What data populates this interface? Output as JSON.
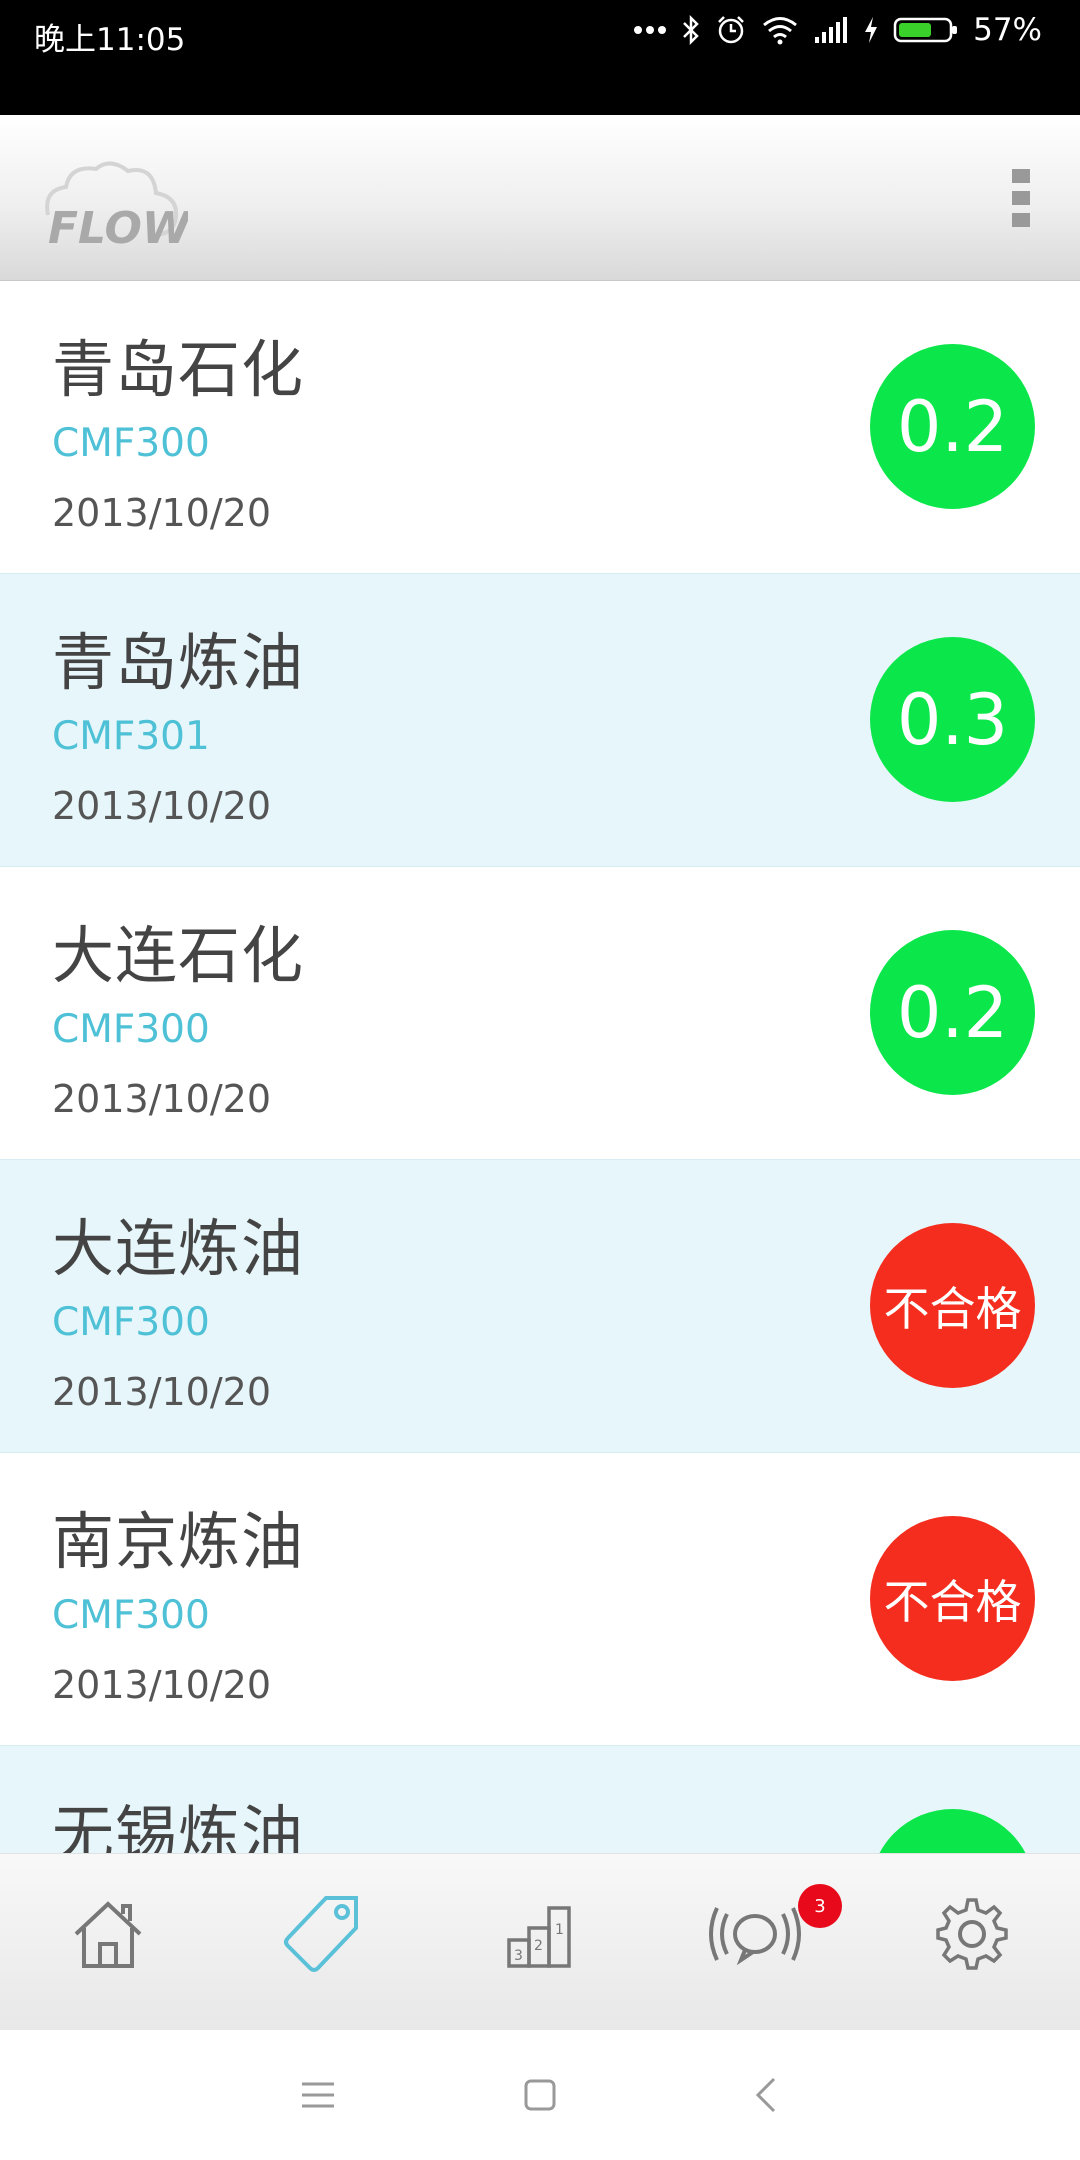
{
  "status_bar": {
    "time": "晚上11:05",
    "battery": "57%"
  },
  "app_bar": {
    "logo_icon": "flow-cloud-logo",
    "menu_icon": "overflow-menu-icon"
  },
  "list": {
    "items": [
      {
        "name": "青岛石化",
        "model": "CMF300",
        "date": "2013/10/20",
        "value": "0.2",
        "status": "ok"
      },
      {
        "name": "青岛炼油",
        "model": "CMF301",
        "date": "2013/10/20",
        "value": "0.3",
        "status": "ok"
      },
      {
        "name": "大连石化",
        "model": "CMF300",
        "date": "2013/10/20",
        "value": "0.2",
        "status": "ok"
      },
      {
        "name": "大连炼油",
        "model": "CMF300",
        "date": "2013/10/20",
        "value": "不合格",
        "status": "fail"
      },
      {
        "name": "南京炼油",
        "model": "CMF300",
        "date": "2013/10/20",
        "value": "不合格",
        "status": "fail"
      },
      {
        "name": "无锡炼油",
        "model": "",
        "date": "",
        "value": "",
        "status": "ok"
      }
    ]
  },
  "tabs": {
    "home_icon": "home-icon",
    "tag_icon": "tag-icon",
    "ranking_icon": "ranking-icon",
    "broadcast_icon": "broadcast-icon",
    "settings_icon": "gear-icon",
    "notification_count": "3"
  },
  "colors": {
    "ok": "#0be64a",
    "fail": "#f42d1e",
    "accent": "#4ec1d6",
    "alt_row": "#e7f6fa"
  }
}
